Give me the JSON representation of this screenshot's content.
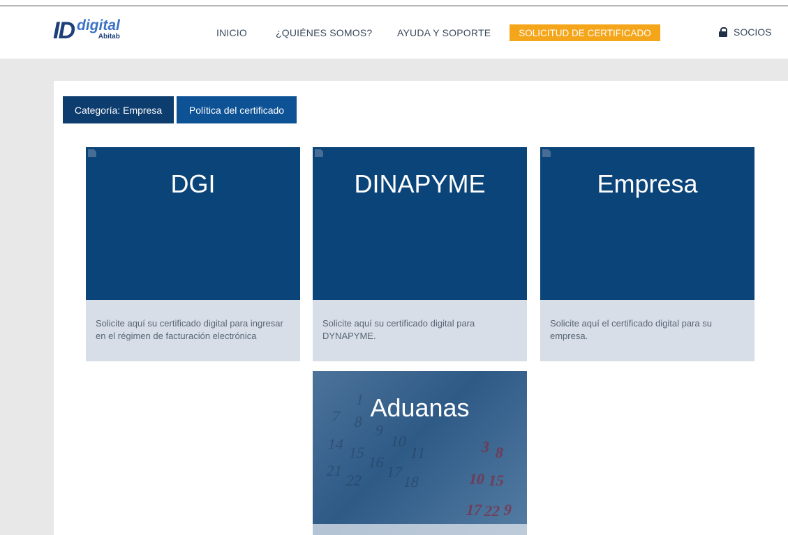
{
  "brand": {
    "id": "ID",
    "digital": "digital",
    "abitab": "Abitab"
  },
  "nav": {
    "items": [
      "INICIO",
      "¿QUIÉNES SOMOS?",
      "AYUDA Y SOPORTE"
    ],
    "cta": "SOLICITUD DE CERTIFICADO",
    "socios": "SOCIOS"
  },
  "tabs": [
    "Categoría: Empresa",
    "Política del certificado"
  ],
  "cards": [
    {
      "title": "DGI",
      "desc": "Solicite aquí su certificado digital para ingresar en el régimen de facturación electrónica"
    },
    {
      "title": "DINAPYME",
      "desc": "Solicite aquí su certificado digital para DYNAPYME."
    },
    {
      "title": "Empresa",
      "desc": "Solicite aquí el certificado digital para su empresa."
    },
    {
      "title": "Aduanas",
      "calendar_numbers": [
        "1",
        "7",
        "8",
        "9",
        "10",
        "11",
        "14",
        "15",
        "16",
        "17",
        "18",
        "21",
        "22",
        "3",
        "8",
        "10",
        "15",
        "17",
        "22",
        "9"
      ]
    }
  ],
  "colors": {
    "brand_dark": "#0b4478",
    "cta": "#f4a519",
    "tab_primary": "#0d3c6e",
    "tab_secondary": "#0d5295"
  }
}
